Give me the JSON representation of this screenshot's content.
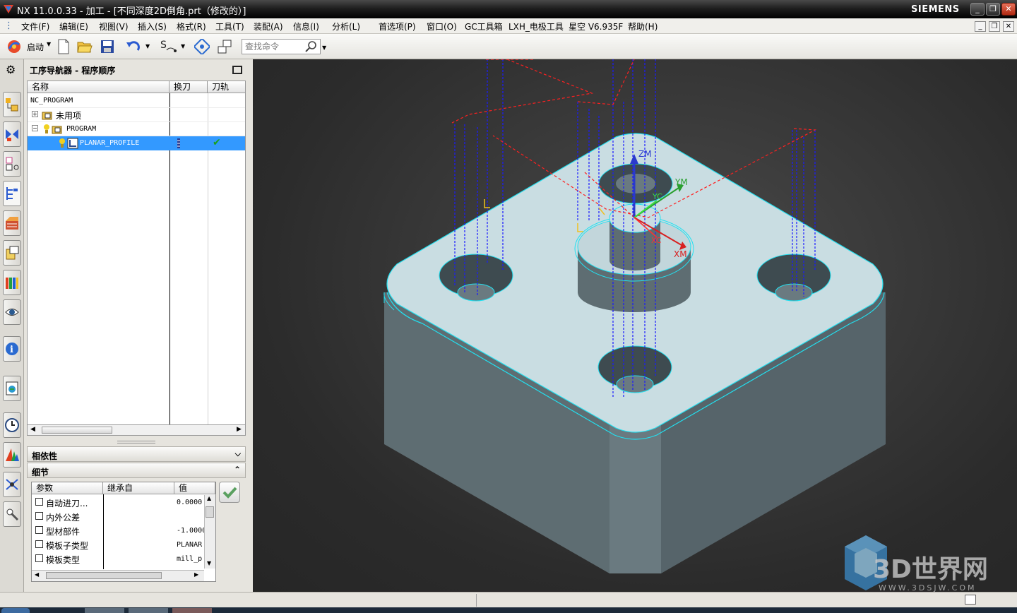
{
  "window": {
    "title": "NX 11.0.0.33 - 加工 - [不同深度2D倒角.prt（修改的）]",
    "brand": "SIEMENS",
    "buttons": {
      "min": "_",
      "max": "❐",
      "close": "✕"
    }
  },
  "menubar": {
    "items": [
      "文件(F)",
      "编辑(E)",
      "视图(V)",
      "插入(S)",
      "格式(R)",
      "工具(T)",
      "装配(A)",
      "信息(I)",
      "分析(L)",
      "首选项(P)",
      "窗口(O)",
      "GC工具箱",
      "LXH_电极工具",
      "星空 V6.935F",
      "帮助(H)"
    ]
  },
  "toolbar": {
    "start_label": "启动",
    "search_placeholder": "查找命令"
  },
  "navigator": {
    "title": "工序导航器 - 程序顺序",
    "columns": [
      "名称",
      "换刀",
      "刀轨"
    ],
    "rows": [
      {
        "name": "NC_PROGRAM"
      },
      {
        "name": "未用项"
      },
      {
        "name": "PROGRAM"
      },
      {
        "name": "PLANAR_PROFILE",
        "selected": true,
        "toolpath_ok": "✔"
      }
    ]
  },
  "dependencies": {
    "label": "相依性"
  },
  "details": {
    "label": "细节",
    "columns": [
      "参数",
      "继承自",
      "值"
    ],
    "rows": [
      {
        "param": "自动进刀...",
        "value": "0.0000"
      },
      {
        "param": "内外公差",
        "value": ""
      },
      {
        "param": "型材部件",
        "value": "-1.0000"
      },
      {
        "param": "模板子类型",
        "value": "PLANAR"
      },
      {
        "param": "模板类型",
        "value": "mill_p"
      }
    ]
  },
  "viewport": {
    "axis_labels": {
      "zm": "ZM",
      "ym": "YM",
      "yc": "YC",
      "xm": "XM",
      "xc": "XC"
    }
  },
  "watermark": {
    "name": "3D世界网",
    "url": "WWW.3DSJW.COM"
  },
  "colors": {
    "selection": "#3399ff",
    "toolpath_blue": "#1a1aff",
    "toolpath_red": "#ff2020",
    "edge_cyan": "#22e0f0",
    "part_top": "#c9dde2",
    "part_side": "#5c6b70"
  }
}
